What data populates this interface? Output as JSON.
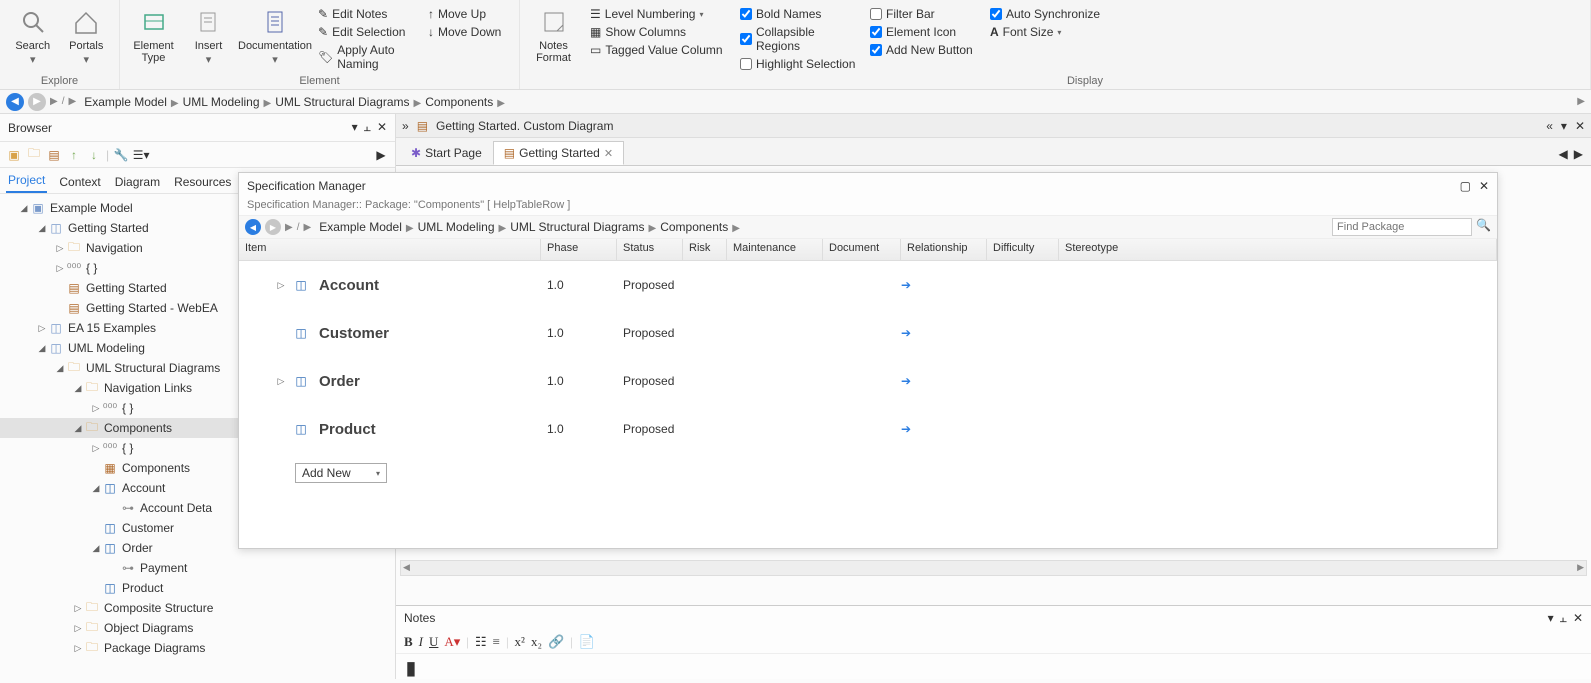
{
  "ribbon": {
    "explore": {
      "label": "Explore",
      "search": "Search",
      "portals": "Portals"
    },
    "element": {
      "label": "Element",
      "elemType": "Element Type",
      "insert": "Insert",
      "doc": "Documentation",
      "editNotes": "Edit Notes",
      "editSel": "Edit Selection",
      "applyAuto": "Apply Auto Naming",
      "moveUp": "Move Up",
      "moveDown": "Move Down",
      "notesFmt": "Notes Format"
    },
    "display": {
      "label": "Display",
      "levelNum": "Level Numbering",
      "showCols": "Show Columns",
      "tagged": "Tagged Value Column",
      "bold": "Bold Names",
      "collapsible": "Collapsible Regions",
      "highlight": "Highlight Selection",
      "filter": "Filter Bar",
      "elemIcon": "Element Icon",
      "addNew": "Add New Button",
      "autoSync": "Auto Synchronize",
      "fontSize": "Font Size"
    }
  },
  "breadcrumb": [
    "Example Model",
    "UML Modeling",
    "UML Structural Diagrams",
    "Components"
  ],
  "browser": {
    "title": "Browser",
    "tabs": [
      "Project",
      "Context",
      "Diagram",
      "Resources"
    ],
    "tree": [
      {
        "d": 1,
        "tw": "▲",
        "ic": "pkg",
        "t": "Example Model"
      },
      {
        "d": 2,
        "tw": "▲",
        "ic": "pkgv",
        "t": "Getting Started"
      },
      {
        "d": 3,
        "tw": "▷",
        "ic": "folder",
        "t": "Navigation"
      },
      {
        "d": 3,
        "tw": "▷",
        "ic": "braces",
        "t": "{ }"
      },
      {
        "d": 3,
        "tw": "",
        "ic": "dia",
        "t": "Getting Started"
      },
      {
        "d": 3,
        "tw": "",
        "ic": "dia",
        "t": "Getting Started - WebEA"
      },
      {
        "d": 2,
        "tw": "▷",
        "ic": "pkgv",
        "t": "EA 15 Examples"
      },
      {
        "d": 2,
        "tw": "▲",
        "ic": "pkgv",
        "t": "UML Modeling"
      },
      {
        "d": 3,
        "tw": "▲",
        "ic": "folder",
        "t": "UML Structural Diagrams"
      },
      {
        "d": 4,
        "tw": "▲",
        "ic": "folder",
        "t": "Navigation Links"
      },
      {
        "d": 5,
        "tw": "▷",
        "ic": "braces",
        "t": "{ }"
      },
      {
        "d": 4,
        "tw": "▲",
        "ic": "folder",
        "t": "Components",
        "sel": true
      },
      {
        "d": 5,
        "tw": "▷",
        "ic": "braces",
        "t": "{ }"
      },
      {
        "d": 5,
        "tw": "",
        "ic": "diac",
        "t": "Components"
      },
      {
        "d": 5,
        "tw": "▲",
        "ic": "comp",
        "t": "Account"
      },
      {
        "d": 6,
        "tw": "",
        "ic": "iface",
        "t": "Account Deta"
      },
      {
        "d": 5,
        "tw": "",
        "ic": "comp",
        "t": "Customer"
      },
      {
        "d": 5,
        "tw": "▲",
        "ic": "comp",
        "t": "Order"
      },
      {
        "d": 6,
        "tw": "",
        "ic": "iface",
        "t": "Payment"
      },
      {
        "d": 5,
        "tw": "",
        "ic": "comp",
        "t": "Product"
      },
      {
        "d": 4,
        "tw": "▷",
        "ic": "folder",
        "t": "Composite Structure"
      },
      {
        "d": 4,
        "tw": "▷",
        "ic": "folder",
        "t": "Object Diagrams"
      },
      {
        "d": 4,
        "tw": "▷",
        "ic": "folder",
        "t": "Package Diagrams"
      }
    ]
  },
  "tabstrip": {
    "caption": "Getting Started.  Custom Diagram"
  },
  "docTabs": {
    "start": "Start Page",
    "getting": "Getting Started"
  },
  "spec": {
    "title": "Specification Manager",
    "sub": "Specification Manager::   Package: \"Components\"   [ HelpTableRow ]",
    "bc": [
      "Example Model",
      "UML Modeling",
      "UML Structural Diagrams",
      "Components"
    ],
    "findPh": "Find Package",
    "cols": [
      "Item",
      "Phase",
      "Status",
      "Risk",
      "Maintenance",
      "Document",
      "Relationship",
      "Difficulty",
      "Stereotype"
    ],
    "rows": [
      {
        "name": "Account",
        "phase": "1.0",
        "status": "Proposed",
        "exp": "▷"
      },
      {
        "name": "Customer",
        "phase": "1.0",
        "status": "Proposed",
        "exp": ""
      },
      {
        "name": "Order",
        "phase": "1.0",
        "status": "Proposed",
        "exp": "▷"
      },
      {
        "name": "Product",
        "phase": "1.0",
        "status": "Proposed",
        "exp": ""
      }
    ],
    "addNew": "Add New"
  },
  "notes": {
    "title": "Notes"
  }
}
